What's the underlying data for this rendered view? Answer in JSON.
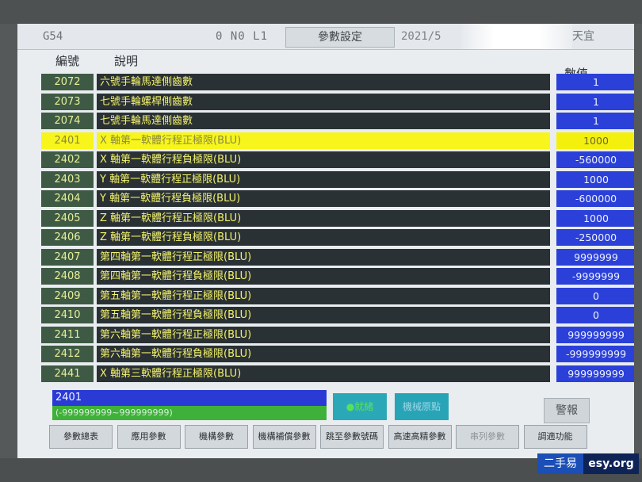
{
  "header": {
    "coord": "G54",
    "status": "0 N0 L1",
    "tab": "參數設定",
    "date": "2021/5",
    "unit": "天宜"
  },
  "columns": {
    "no": "編號",
    "desc": "說明",
    "value": "數值"
  },
  "rows": [
    {
      "no": "2072",
      "desc": "六號手輪馬達側齒數",
      "value": "1",
      "selected": false
    },
    {
      "no": "2073",
      "desc": "七號手輪螺桿側齒數",
      "value": "1",
      "selected": false
    },
    {
      "no": "2074",
      "desc": "七號手輪馬達側齒數",
      "value": "1",
      "selected": false
    },
    {
      "no": "2401",
      "desc": "X 軸第一軟體行程正極限(BLU)",
      "value": "1000",
      "selected": true
    },
    {
      "no": "2402",
      "desc": "X 軸第一軟體行程負極限(BLU)",
      "value": "-560000",
      "selected": false
    },
    {
      "no": "2403",
      "desc": "Y 軸第一軟體行程正極限(BLU)",
      "value": "1000",
      "selected": false
    },
    {
      "no": "2404",
      "desc": "Y 軸第一軟體行程負極限(BLU)",
      "value": "-600000",
      "selected": false
    },
    {
      "no": "2405",
      "desc": "Z 軸第一軟體行程正極限(BLU)",
      "value": "1000",
      "selected": false
    },
    {
      "no": "2406",
      "desc": "Z 軸第一軟體行程負極限(BLU)",
      "value": "-250000",
      "selected": false
    },
    {
      "no": "2407",
      "desc": "第四軸第一軟體行程正極限(BLU)",
      "value": "9999999",
      "selected": false
    },
    {
      "no": "2408",
      "desc": "第四軸第一軟體行程負極限(BLU)",
      "value": "-9999999",
      "selected": false
    },
    {
      "no": "2409",
      "desc": "第五軸第一軟體行程正極限(BLU)",
      "value": "0",
      "selected": false
    },
    {
      "no": "2410",
      "desc": "第五軸第一軟體行程負極限(BLU)",
      "value": "0",
      "selected": false
    },
    {
      "no": "2411",
      "desc": "第六軸第一軟體行程正極限(BLU)",
      "value": "999999999",
      "selected": false
    },
    {
      "no": "2412",
      "desc": "第六軸第一軟體行程負極限(BLU)",
      "value": "-999999999",
      "selected": false
    },
    {
      "no": "2441",
      "desc": "X 軸第三軟體行程正極限(BLU)",
      "value": "999999999",
      "selected": false
    }
  ],
  "input": {
    "value": "2401",
    "range": "(-999999999~999999999)"
  },
  "indicators": {
    "run": "●就緒",
    "origin": "機械原點"
  },
  "alarm": "警報",
  "fkeys": [
    "參數總表",
    "應用參數",
    "機構參數",
    "機構補償參數",
    "跳至參數號碼",
    "高速高精參數",
    "串列參數",
    "調適功能"
  ],
  "watermark": {
    "left": "二手易",
    "right": "esy.org"
  }
}
